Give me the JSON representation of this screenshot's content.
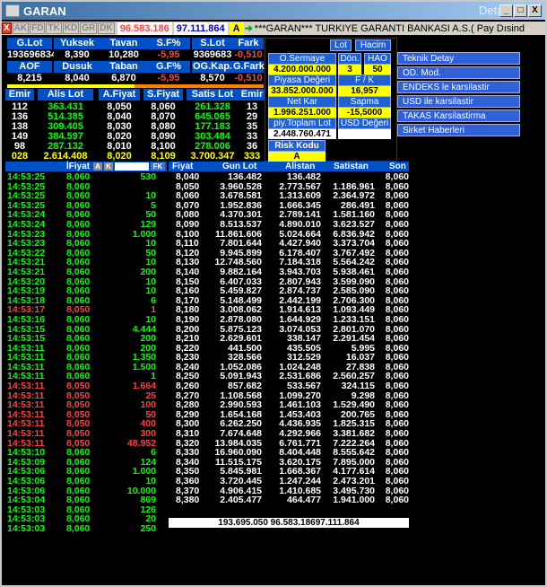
{
  "window": {
    "title": "GARAN",
    "detay": "Detay",
    "buttons": [
      "_",
      "□",
      "X"
    ]
  },
  "toolbar": {
    "tabs": [
      "X",
      "AK",
      "FD",
      "TK",
      "KD",
      "GR",
      "DK"
    ],
    "value1": "96.583.186",
    "value2": "97.111.864",
    "a_label": "A",
    "ticker": "***GARAN*** TURKIYE GARANTI BANKASI A.S.( Pay Dısind"
  },
  "summary": {
    "headers1": [
      "G.Lot",
      "Yuksek",
      "Tavan",
      "S.F%",
      "S.Lot",
      "Fark"
    ],
    "values1": [
      "193696834",
      "8,390",
      "10,280",
      "-5,95",
      "9369683",
      "-0,510"
    ],
    "headers2": [
      "AOF",
      "Dusuk",
      "Taban",
      "G.F%",
      "OG.Kap.",
      "G.Fark"
    ],
    "values2": [
      "8,215",
      "8,040",
      "6,870",
      "-5,95",
      "8,570",
      "-0,510"
    ]
  },
  "depth": {
    "headers": [
      "Emir",
      "Alis Lot",
      "A.Fiyat",
      "S.Fiyat",
      "Satis Lot",
      "Emir"
    ],
    "rows": [
      [
        "112",
        "363.431",
        "8,050",
        "8,060",
        "261.328",
        "13"
      ],
      [
        "136",
        "514.385",
        "8,040",
        "8,070",
        "645.065",
        "29"
      ],
      [
        "138",
        "309.405",
        "8,030",
        "8,080",
        "177.183",
        "35"
      ],
      [
        "149",
        "384.597",
        "8,020",
        "8,090",
        "303.484",
        "33"
      ],
      [
        "98",
        "287.132",
        "8,010",
        "8,100",
        "278.006",
        "36"
      ]
    ],
    "total": [
      "028",
      "2.614.408",
      "8,020",
      "8,109",
      "3.700.347",
      "333"
    ]
  },
  "panel": {
    "tabs": [
      "Lot",
      "Hacim"
    ],
    "o_sermaye_label": "O.Sermaye",
    "o_sermaye": "4.200.000.000",
    "don_label": "Dön.",
    "don": "3",
    "hao_label": "HAO",
    "hao": "50",
    "piyasa_label": "Piyasa Değeri",
    "piyasa": "33.852.000.000",
    "fk_label": "F / K",
    "fk": "16,957",
    "netkar_label": "Net Kar",
    "netkar": "1.996.251.000",
    "sapma_label": "Sapma",
    "sapma": "-15,5000",
    "toplam_label": "piy.Toplam Lot",
    "toplam": "2.448.760.471",
    "usd_label": "USD Değeri",
    "risk_label": "Risk Kodu",
    "risk": "A"
  },
  "menu": [
    "Teknik Detay",
    "OD. Mod.",
    "ENDEKS le karsilastir",
    "USD ile karsilastir",
    "TAKAS Karsilastirma",
    "Sirket Haberleri"
  ],
  "trades_header": {
    "fiyat": "İFiyat",
    "ak1": "A",
    "ak2": "K",
    "fk": "FK"
  },
  "trades": [
    [
      "14:53:25",
      "8,060",
      "530",
      "g"
    ],
    [
      "14:53:25",
      "8,060",
      "",
      "g"
    ],
    [
      "14:53:25",
      "8,060",
      "10",
      "g"
    ],
    [
      "14:53:25",
      "8,060",
      "5",
      "g"
    ],
    [
      "14:53:24",
      "8,060",
      "50",
      "g"
    ],
    [
      "14:53:24",
      "8,060",
      "129",
      "g"
    ],
    [
      "14:53:23",
      "8,060",
      "1.000",
      "g"
    ],
    [
      "14:53:23",
      "8,060",
      "10",
      "g"
    ],
    [
      "14:53:22",
      "8,060",
      "50",
      "g"
    ],
    [
      "14:53:21",
      "8,060",
      "10",
      "g"
    ],
    [
      "14:53:21",
      "8,060",
      "200",
      "g"
    ],
    [
      "14:53:20",
      "8,060",
      "10",
      "g"
    ],
    [
      "14:53:19",
      "8,060",
      "10",
      "g"
    ],
    [
      "14:53:18",
      "8,060",
      "6",
      "g"
    ],
    [
      "14:53:17",
      "8,050",
      "1",
      "r"
    ],
    [
      "14:53:16",
      "8,060",
      "10",
      "g"
    ],
    [
      "14:53:15",
      "8,060",
      "4.444",
      "g"
    ],
    [
      "14:53:15",
      "8,060",
      "200",
      "g"
    ],
    [
      "14:53:11",
      "8,060",
      "200",
      "g"
    ],
    [
      "14:53:11",
      "8,060",
      "1.350",
      "g"
    ],
    [
      "14:53:11",
      "8,060",
      "1.500",
      "g"
    ],
    [
      "14:53:11",
      "8,060",
      "1",
      "g"
    ],
    [
      "14:53:11",
      "8,050",
      "1.664",
      "r"
    ],
    [
      "14:53:11",
      "8,050",
      "25",
      "r"
    ],
    [
      "14:53:11",
      "8,050",
      "100",
      "r"
    ],
    [
      "14:53:11",
      "8,050",
      "50",
      "r"
    ],
    [
      "14:53:11",
      "8,050",
      "400",
      "r"
    ],
    [
      "14:53:11",
      "8,050",
      "300",
      "r"
    ],
    [
      "14:53:11",
      "8,050",
      "48.952",
      "r"
    ],
    [
      "14:53:10",
      "8,060",
      "6",
      "g"
    ],
    [
      "14:53:09",
      "8,060",
      "124",
      "g"
    ],
    [
      "14:53:06",
      "8,060",
      "1.000",
      "g"
    ],
    [
      "14:53:06",
      "8,060",
      "10",
      "g"
    ],
    [
      "14:53:06",
      "8,060",
      "10.000",
      "g"
    ],
    [
      "14:53:04",
      "8,060",
      "869",
      "g"
    ],
    [
      "14:53:03",
      "8,060",
      "126",
      "g"
    ],
    [
      "14:53:03",
      "8,060",
      "20",
      "g"
    ],
    [
      "14:53:03",
      "8,060",
      "250",
      "g"
    ]
  ],
  "book_header": [
    "Fiyat",
    "Gun Lot",
    "Alistan",
    "Satistan",
    "Son"
  ],
  "book": [
    [
      "8,040",
      "136.482",
      "136.482",
      "",
      "8,060"
    ],
    [
      "8,050",
      "3.960.528",
      "2.773.567",
      "1.186.961",
      "8,060"
    ],
    [
      "8,060",
      "3.678.581",
      "1.313.609",
      "2.364.972",
      "8,060"
    ],
    [
      "8,070",
      "1.952.836",
      "1.666.345",
      "286.491",
      "8,060"
    ],
    [
      "8,080",
      "4.370.301",
      "2.789.141",
      "1.581.160",
      "8,060"
    ],
    [
      "8,090",
      "8.513.537",
      "4.890.010",
      "3.623.527",
      "8,060"
    ],
    [
      "8,100",
      "11.861.606",
      "5.024.664",
      "6.836.942",
      "8,060"
    ],
    [
      "8,110",
      "7.801.644",
      "4.427.940",
      "3.373.704",
      "8,060"
    ],
    [
      "8,120",
      "9.945.899",
      "6.178.407",
      "3.767.492",
      "8,060"
    ],
    [
      "8,130",
      "12.748.560",
      "7.184.318",
      "5.564.242",
      "8,060"
    ],
    [
      "8,140",
      "9.882.164",
      "3.943.703",
      "5.938.461",
      "8,060"
    ],
    [
      "8,150",
      "6.407.033",
      "2.807.943",
      "3.599.090",
      "8,060"
    ],
    [
      "8,160",
      "5.459.827",
      "2.874.737",
      "2.585.090",
      "8,060"
    ],
    [
      "8,170",
      "5.148.499",
      "2.442.199",
      "2.706.300",
      "8,060"
    ],
    [
      "8,180",
      "3.008.062",
      "1.914.613",
      "1.093.449",
      "8,060"
    ],
    [
      "8,190",
      "2.878.080",
      "1.644.929",
      "1.233.151",
      "8,060"
    ],
    [
      "8,200",
      "5.875.123",
      "3.074.053",
      "2.801.070",
      "8,060"
    ],
    [
      "8,210",
      "2.629.601",
      "338.147",
      "2.291.454",
      "8,060"
    ],
    [
      "8,220",
      "441.500",
      "435.505",
      "5.995",
      "8,060"
    ],
    [
      "8,230",
      "328.566",
      "312.529",
      "16.037",
      "8,060"
    ],
    [
      "8,240",
      "1.052.086",
      "1.024.248",
      "27.838",
      "8,060"
    ],
    [
      "8,250",
      "5.091.943",
      "2.531.686",
      "2.560.257",
      "8,060"
    ],
    [
      "8,260",
      "857.682",
      "533.567",
      "324.115",
      "8,060"
    ],
    [
      "8,270",
      "1.108.568",
      "1.099.270",
      "9.298",
      "8,060"
    ],
    [
      "8,280",
      "2.990.593",
      "1.461.103",
      "1.529.490",
      "8,060"
    ],
    [
      "8,290",
      "1.654.168",
      "1.453.403",
      "200.765",
      "8,060"
    ],
    [
      "8,300",
      "6.262.250",
      "4.436.935",
      "1.825.315",
      "8,060"
    ],
    [
      "8,310",
      "7.674.648",
      "4.292.966",
      "3.381.682",
      "8,060"
    ],
    [
      "8,320",
      "13.984.035",
      "6.761.771",
      "7.222.264",
      "8,060"
    ],
    [
      "8,330",
      "16.960.090",
      "8.404.448",
      "8.555.642",
      "8,060"
    ],
    [
      "8,340",
      "11.515.175",
      "3.620.175",
      "7.895.000",
      "8,060"
    ],
    [
      "8,350",
      "5.845.981",
      "1.668.367",
      "4.177.614",
      "8,060"
    ],
    [
      "8,360",
      "3.720.445",
      "1.247.244",
      "2.473.201",
      "8,060"
    ],
    [
      "8,370",
      "4.906.415",
      "1.410.685",
      "3.495.730",
      "8,060"
    ],
    [
      "8,380",
      "2.405.477",
      "464.477",
      "1.941.000",
      "8,060"
    ]
  ],
  "book_total": "193.695.050 96.583.18697.111.864"
}
